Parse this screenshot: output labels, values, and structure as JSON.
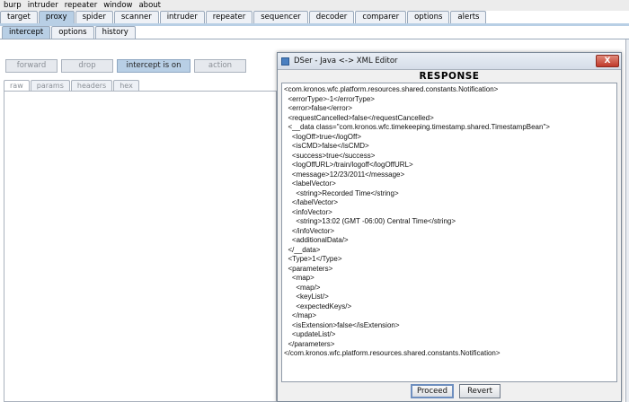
{
  "menu": [
    "burp",
    "intruder",
    "repeater",
    "window",
    "about"
  ],
  "main_tabs": [
    {
      "label": "target",
      "active": false
    },
    {
      "label": "proxy",
      "active": true
    },
    {
      "label": "spider",
      "active": false
    },
    {
      "label": "scanner",
      "active": false
    },
    {
      "label": "intruder",
      "active": false
    },
    {
      "label": "repeater",
      "active": false
    },
    {
      "label": "sequencer",
      "active": false
    },
    {
      "label": "decoder",
      "active": false
    },
    {
      "label": "comparer",
      "active": false
    },
    {
      "label": "options",
      "active": false
    },
    {
      "label": "alerts",
      "active": false
    }
  ],
  "proxy_tabs": [
    {
      "label": "intercept",
      "active": true
    },
    {
      "label": "options",
      "active": false
    },
    {
      "label": "history",
      "active": false
    }
  ],
  "intercept_buttons": {
    "forward": "forward",
    "drop": "drop",
    "intercept": "intercept is on",
    "action": "action"
  },
  "view_tabs": [
    {
      "label": "raw",
      "active": true
    },
    {
      "label": "params",
      "active": false
    },
    {
      "label": "headers",
      "active": false
    },
    {
      "label": "hex",
      "active": false
    }
  ],
  "dialog": {
    "title": "DSer - Java <-> XML Editor",
    "close": "X",
    "header": "RESPONSE",
    "proceed": "Proceed",
    "revert": "Revert",
    "xml_lines": [
      "<com.kronos.wfc.platform.resources.shared.constants.Notification>",
      "  <errorType>-1</errorType>",
      "  <error>false</error>",
      "  <requestCancelled>false</requestCancelled>",
      "  <__data class=\"com.kronos.wfc.timekeeping.timestamp.shared.TimestampBean\">",
      "    <logOff>true</logOff>",
      "    <isCMD>false</isCMD>",
      "    <success>true</success>",
      "    <logOffURL>/train/logoff</logOffURL>",
      "    <message>12/23/2011</message>",
      "    <labelVector>",
      "      <string>Recorded Time</string>",
      "    </labelVector>",
      "    <infoVector>",
      "      <string>13:02 (GMT -06:00) Central Time</string>",
      "    </infoVector>",
      "    <additionalData/>",
      "  </__data>",
      "  <Type>1</Type>",
      "  <parameters>",
      "    <map>",
      "      <map/>",
      "      <keyList/>",
      "      <expectedKeys/>",
      "    </map>",
      "    <isExtension>false</isExtension>",
      "    <updateList/>",
      "  </parameters>",
      "</com.kronos.wfc.platform.resources.shared.constants.Notification>"
    ]
  },
  "colors": {
    "tab_active": "#b8cfe5",
    "tab_inactive": "#eef1f6",
    "close_button": "#c0392b"
  }
}
